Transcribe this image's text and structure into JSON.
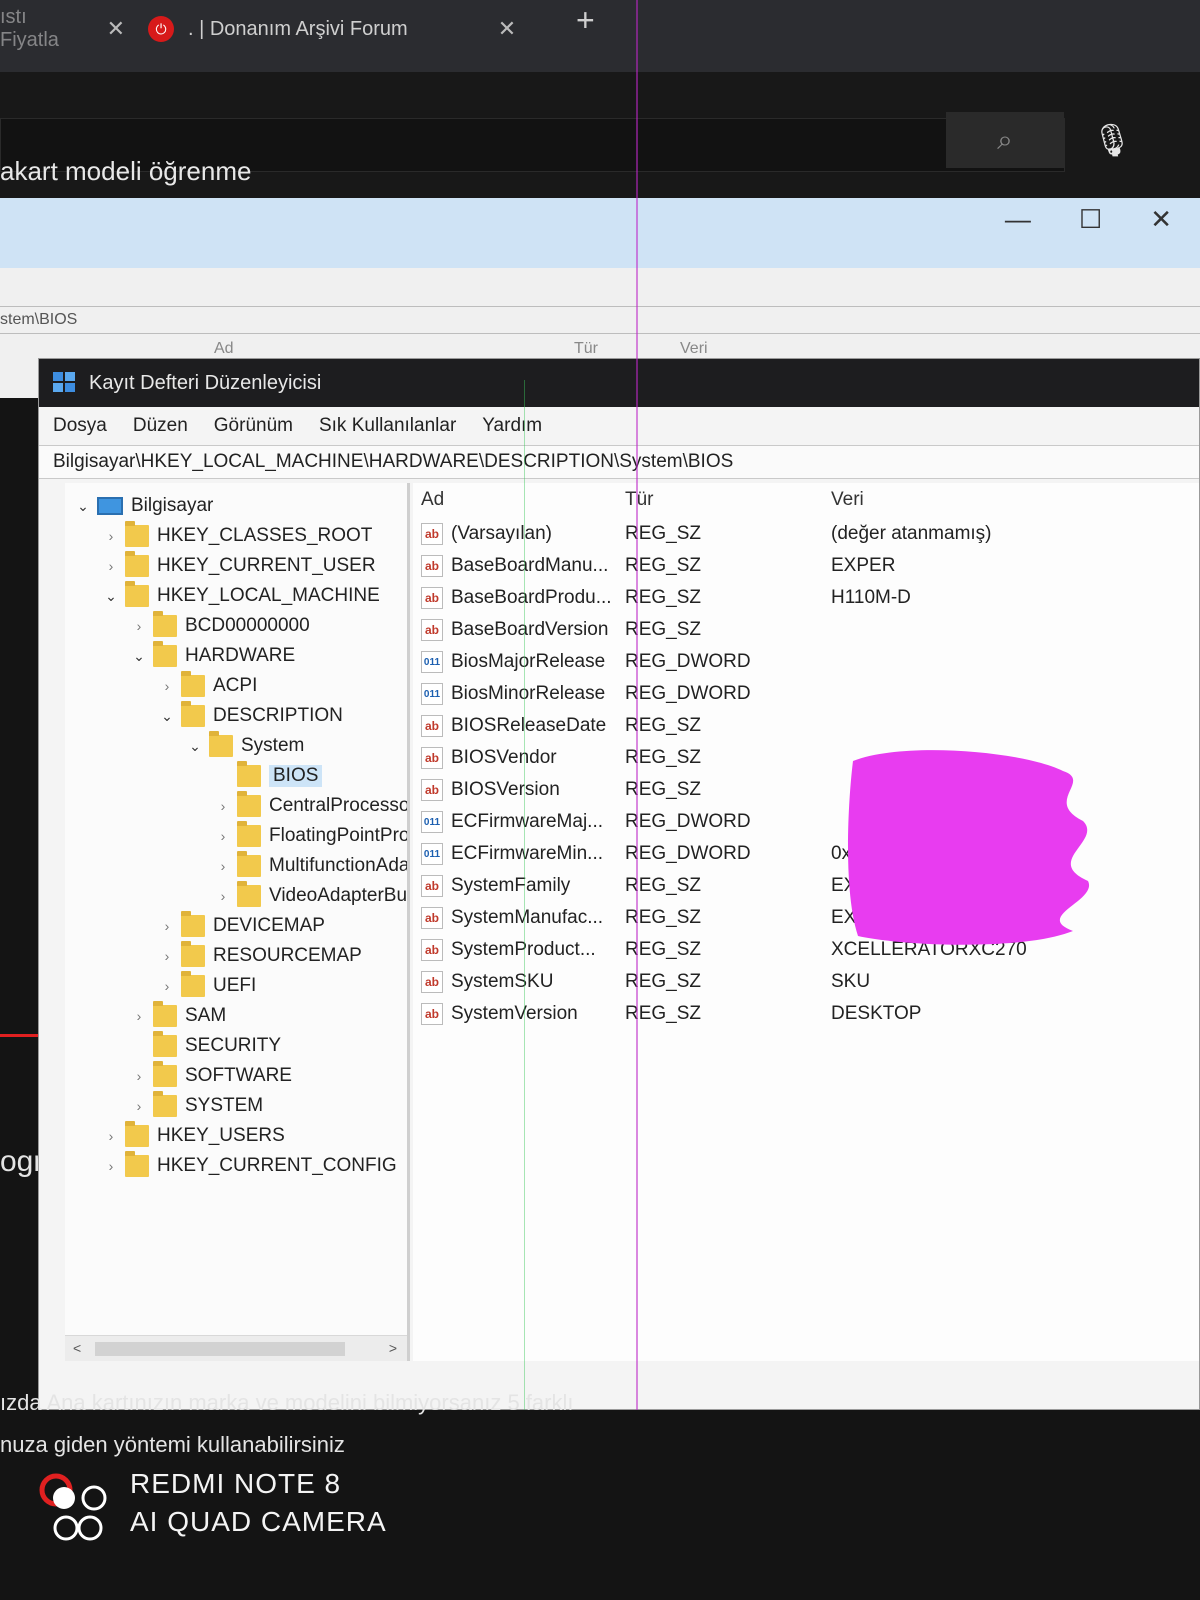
{
  "browser": {
    "tabs": [
      {
        "label": "ıstı Fiyatla",
        "close": "✕"
      },
      {
        "label": ". | Donanım Arşivi Forum",
        "close": "✕"
      }
    ],
    "new_tab": "+",
    "search_query": "akart modeli öğrenme",
    "below_text_1": "ızda Ana kartınızın marka ve modelini bilmiyorsanız 5 farklı",
    "below_text_2": "nuza giden yöntemi kullanabilirsiniz",
    "side_text": "ograr"
  },
  "back_window": {
    "address": "stem\\BIOS",
    "headers": [
      "Ad",
      "Tür",
      "Veri"
    ]
  },
  "regedit": {
    "title": "Kayıt Defteri Düzenleyicisi",
    "menu": [
      "Dosya",
      "Düzen",
      "Görünüm",
      "Sık Kullanılanlar",
      "Yardım"
    ],
    "address": "Bilgisayar\\HKEY_LOCAL_MACHINE\\HARDWARE\\DESCRIPTION\\System\\BIOS",
    "tree": [
      {
        "label": "Bilgisayar",
        "level": 0,
        "state": "open",
        "icon": "computer-icon"
      },
      {
        "label": "HKEY_CLASSES_ROOT",
        "level": 1,
        "state": "closed"
      },
      {
        "label": "HKEY_CURRENT_USER",
        "level": 1,
        "state": "closed"
      },
      {
        "label": "HKEY_LOCAL_MACHINE",
        "level": 1,
        "state": "open"
      },
      {
        "label": "BCD00000000",
        "level": 2,
        "state": "closed"
      },
      {
        "label": "HARDWARE",
        "level": 2,
        "state": "open"
      },
      {
        "label": "ACPI",
        "level": 3,
        "state": "closed"
      },
      {
        "label": "DESCRIPTION",
        "level": 3,
        "state": "open"
      },
      {
        "label": "System",
        "level": 4,
        "state": "open"
      },
      {
        "label": "BIOS",
        "level": 5,
        "state": "none",
        "selected": true
      },
      {
        "label": "CentralProcessor",
        "level": 5,
        "state": "closed"
      },
      {
        "label": "FloatingPointProc",
        "level": 5,
        "state": "closed"
      },
      {
        "label": "MultifunctionAda",
        "level": 5,
        "state": "closed"
      },
      {
        "label": "VideoAdapterBus",
        "level": 5,
        "state": "closed"
      },
      {
        "label": "DEVICEMAP",
        "level": 3,
        "state": "closed"
      },
      {
        "label": "RESOURCEMAP",
        "level": 3,
        "state": "closed"
      },
      {
        "label": "UEFI",
        "level": 3,
        "state": "closed"
      },
      {
        "label": "SAM",
        "level": 2,
        "state": "closed"
      },
      {
        "label": "SECURITY",
        "level": 2,
        "state": "none"
      },
      {
        "label": "SOFTWARE",
        "level": 2,
        "state": "closed"
      },
      {
        "label": "SYSTEM",
        "level": 2,
        "state": "closed"
      },
      {
        "label": "HKEY_USERS",
        "level": 1,
        "state": "closed"
      },
      {
        "label": "HKEY_CURRENT_CONFIG",
        "level": 1,
        "state": "closed"
      }
    ],
    "columns": {
      "name": "Ad",
      "type": "Tür",
      "data": "Veri"
    },
    "values": [
      {
        "name": "(Varsayılan)",
        "type": "REG_SZ",
        "data": "(değer atanmamış)",
        "icon": "ab"
      },
      {
        "name": "BaseBoardManu...",
        "type": "REG_SZ",
        "data": "EXPER",
        "icon": "ab"
      },
      {
        "name": "BaseBoardProdu...",
        "type": "REG_SZ",
        "data": "H110M-D",
        "icon": "ab"
      },
      {
        "name": "BaseBoardVersion",
        "type": "REG_SZ",
        "data": "",
        "icon": "ab"
      },
      {
        "name": "BiosMajorRelease",
        "type": "REG_DWORD",
        "data": "",
        "icon": "dword"
      },
      {
        "name": "BiosMinorRelease",
        "type": "REG_DWORD",
        "data": "",
        "icon": "dword"
      },
      {
        "name": "BIOSReleaseDate",
        "type": "REG_SZ",
        "data": "",
        "icon": "ab"
      },
      {
        "name": "BIOSVendor",
        "type": "REG_SZ",
        "data": "",
        "icon": "ab"
      },
      {
        "name": "BIOSVersion",
        "type": "REG_SZ",
        "data": "",
        "icon": "ab"
      },
      {
        "name": "ECFirmwareMaj...",
        "type": "REG_DWORD",
        "data": "",
        "icon": "dword"
      },
      {
        "name": "ECFirmwareMin...",
        "type": "REG_DWORD",
        "data": "0x000000ff (255)",
        "icon": "dword"
      },
      {
        "name": "SystemFamily",
        "type": "REG_SZ",
        "data": "EXPER-MB",
        "icon": "ab"
      },
      {
        "name": "SystemManufac...",
        "type": "REG_SZ",
        "data": "EXPER",
        "icon": "ab"
      },
      {
        "name": "SystemProduct...",
        "type": "REG_SZ",
        "data": "XCELLERATORXC270",
        "icon": "ab"
      },
      {
        "name": "SystemSKU",
        "type": "REG_SZ",
        "data": "SKU",
        "icon": "ab"
      },
      {
        "name": "SystemVersion",
        "type": "REG_SZ",
        "data": "DESKTOP",
        "icon": "ab"
      }
    ],
    "redaction_color": "#e83cf0"
  },
  "watermark": {
    "line1": "REDMI NOTE 8",
    "line2": "AI QUAD CAMERA"
  }
}
